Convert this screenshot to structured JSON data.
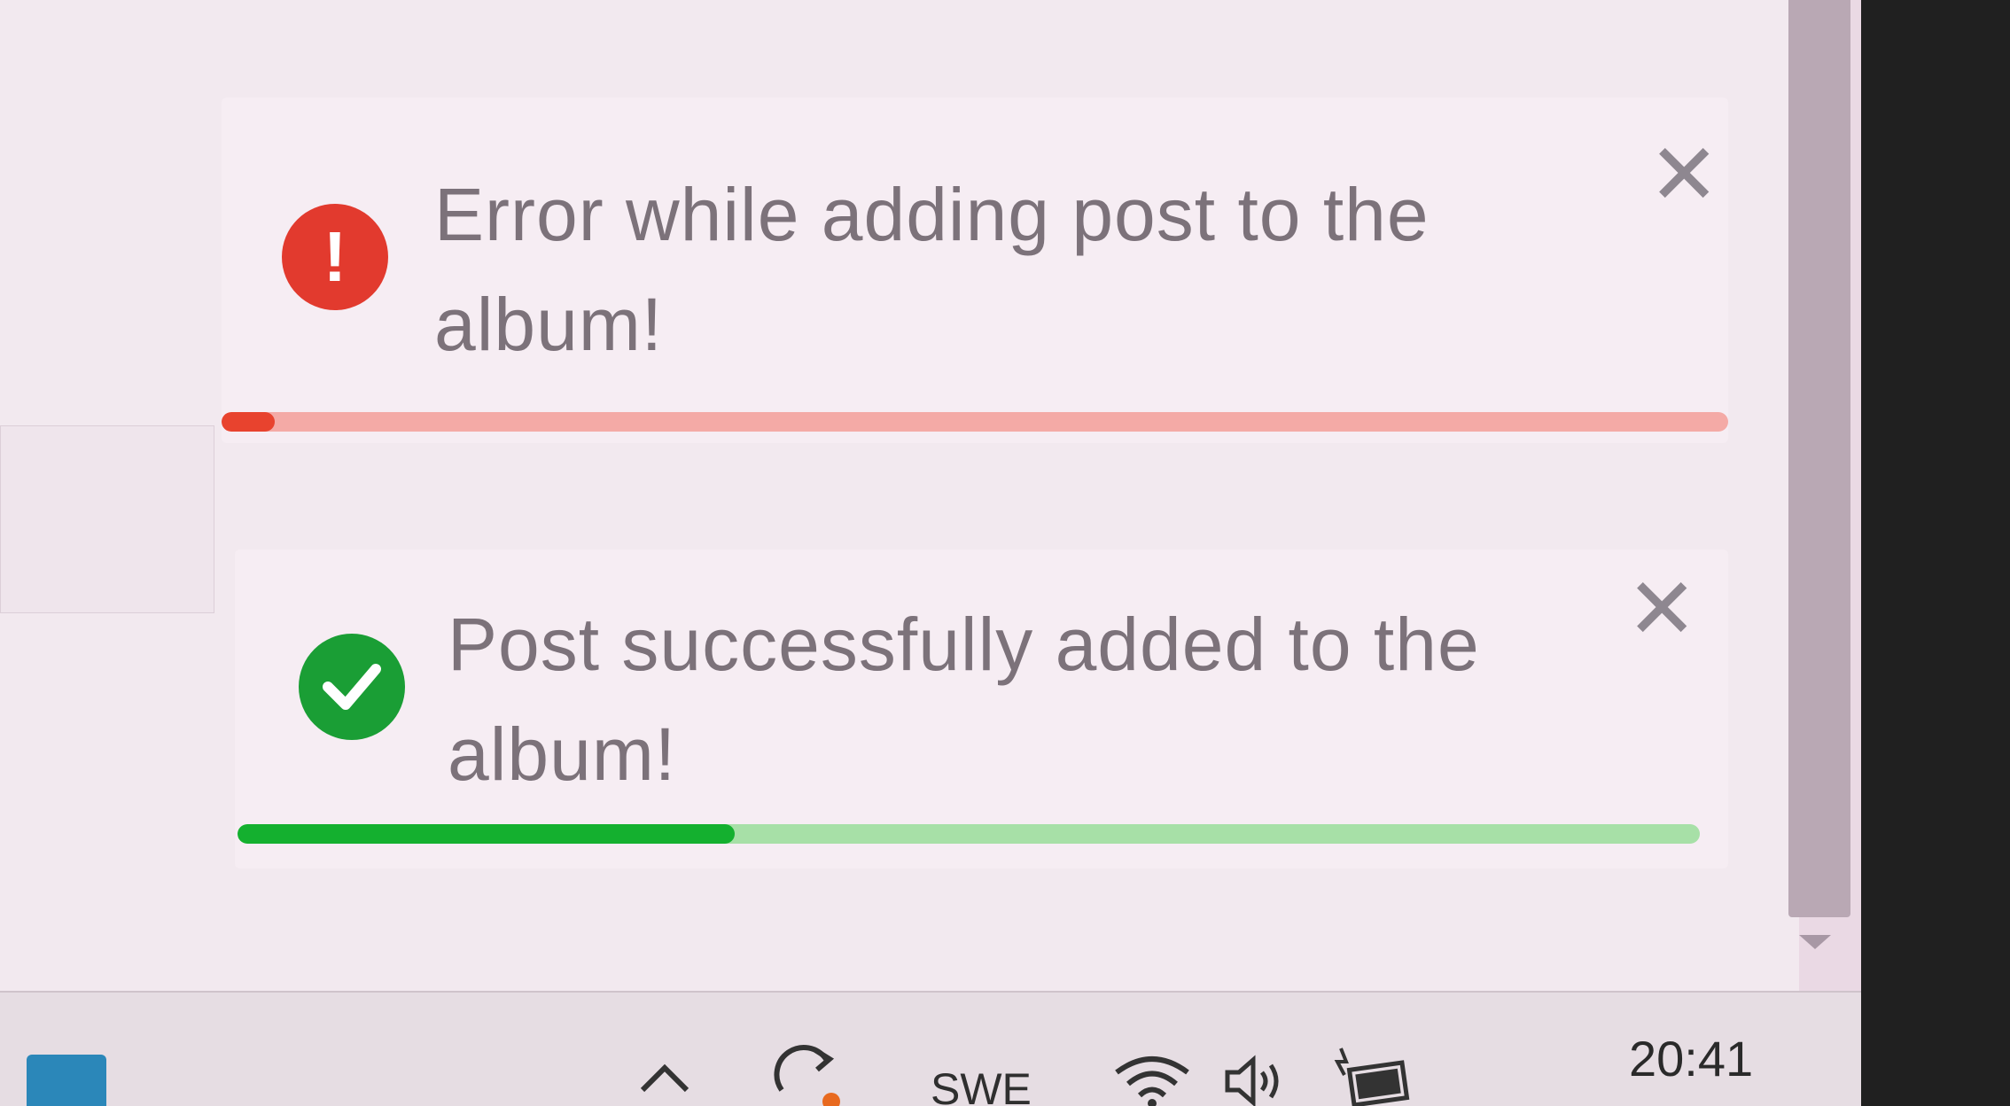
{
  "toasts": [
    {
      "type": "error",
      "message": "Error while adding post to the album!",
      "icon": "exclamation-icon",
      "close_label": "✕",
      "progress": 0.035,
      "accent": "#e23a2e"
    },
    {
      "type": "success",
      "message": "Post successfully added to the album!",
      "icon": "checkmark-icon",
      "close_label": "✕",
      "progress": 0.34,
      "accent": "#1a9e35"
    }
  ],
  "taskbar": {
    "language": "SWE",
    "clock": "20:41"
  }
}
